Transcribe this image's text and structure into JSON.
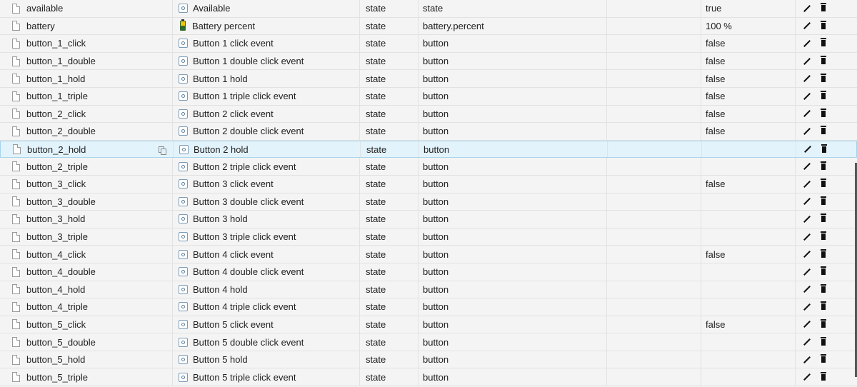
{
  "rows": [
    {
      "id": "available",
      "name": "Available",
      "type": "state",
      "role": "state",
      "value": "true",
      "icon": "state"
    },
    {
      "id": "battery",
      "name": "Battery percent",
      "type": "state",
      "role": "battery.percent",
      "value": "100 %",
      "icon": "battery"
    },
    {
      "id": "button_1_click",
      "name": "Button 1 click event",
      "type": "state",
      "role": "button",
      "value": "false",
      "icon": "state"
    },
    {
      "id": "button_1_double",
      "name": "Button 1 double click event",
      "type": "state",
      "role": "button",
      "value": "false",
      "icon": "state"
    },
    {
      "id": "button_1_hold",
      "name": "Button 1 hold",
      "type": "state",
      "role": "button",
      "value": "false",
      "icon": "state"
    },
    {
      "id": "button_1_triple",
      "name": "Button 1 triple click event",
      "type": "state",
      "role": "button",
      "value": "false",
      "icon": "state"
    },
    {
      "id": "button_2_click",
      "name": "Button 2 click event",
      "type": "state",
      "role": "button",
      "value": "false",
      "icon": "state"
    },
    {
      "id": "button_2_double",
      "name": "Button 2 double click event",
      "type": "state",
      "role": "button",
      "value": "false",
      "icon": "state"
    },
    {
      "id": "button_2_hold",
      "name": "Button 2 hold",
      "type": "state",
      "role": "button",
      "value": "",
      "icon": "state",
      "selected": true
    },
    {
      "id": "button_2_triple",
      "name": "Button 2 triple click event",
      "type": "state",
      "role": "button",
      "value": "",
      "icon": "state"
    },
    {
      "id": "button_3_click",
      "name": "Button 3 click event",
      "type": "state",
      "role": "button",
      "value": "false",
      "icon": "state"
    },
    {
      "id": "button_3_double",
      "name": "Button 3 double click event",
      "type": "state",
      "role": "button",
      "value": "",
      "icon": "state"
    },
    {
      "id": "button_3_hold",
      "name": "Button 3 hold",
      "type": "state",
      "role": "button",
      "value": "",
      "icon": "state"
    },
    {
      "id": "button_3_triple",
      "name": "Button 3 triple click event",
      "type": "state",
      "role": "button",
      "value": "",
      "icon": "state"
    },
    {
      "id": "button_4_click",
      "name": "Button 4 click event",
      "type": "state",
      "role": "button",
      "value": "false",
      "icon": "state"
    },
    {
      "id": "button_4_double",
      "name": "Button 4 double click event",
      "type": "state",
      "role": "button",
      "value": "",
      "icon": "state"
    },
    {
      "id": "button_4_hold",
      "name": "Button 4 hold",
      "type": "state",
      "role": "button",
      "value": "",
      "icon": "state"
    },
    {
      "id": "button_4_triple",
      "name": "Button 4 triple click event",
      "type": "state",
      "role": "button",
      "value": "",
      "icon": "state"
    },
    {
      "id": "button_5_click",
      "name": "Button 5 click event",
      "type": "state",
      "role": "button",
      "value": "false",
      "icon": "state"
    },
    {
      "id": "button_5_double",
      "name": "Button 5 double click event",
      "type": "state",
      "role": "button",
      "value": "",
      "icon": "state"
    },
    {
      "id": "button_5_hold",
      "name": "Button 5 hold",
      "type": "state",
      "role": "button",
      "value": "",
      "icon": "state"
    },
    {
      "id": "button_5_triple",
      "name": "Button 5 triple click event",
      "type": "state",
      "role": "button",
      "value": "",
      "icon": "state"
    }
  ],
  "colors": {
    "selected_row": "#e3f3fb",
    "row_bg": "#f4f4f4",
    "border": "#e2e2e2"
  }
}
